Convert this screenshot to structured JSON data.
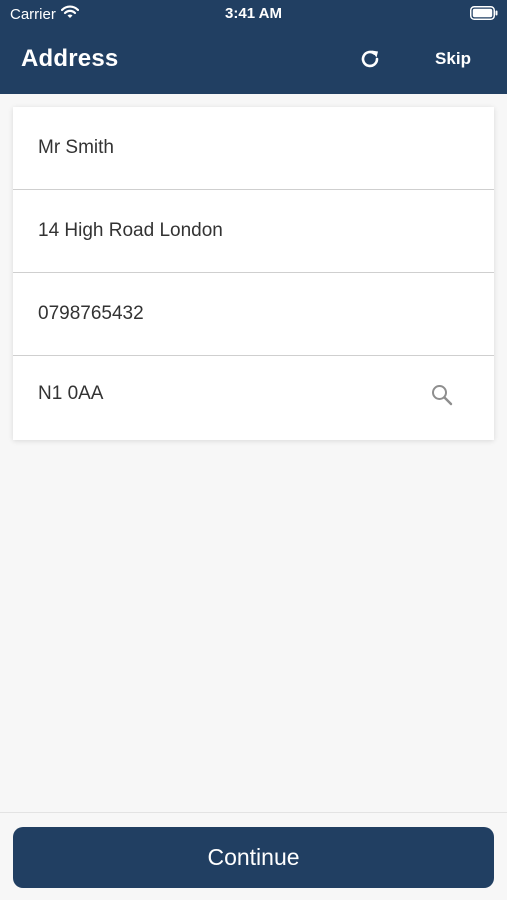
{
  "status_bar": {
    "carrier": "Carrier",
    "time": "3:41 AM"
  },
  "nav": {
    "title": "Address",
    "skip_label": "Skip"
  },
  "form": {
    "fields": [
      {
        "value": "Mr Smith"
      },
      {
        "value": "14 High Road London"
      },
      {
        "value": "0798765432"
      },
      {
        "value": "N1 0AA"
      }
    ]
  },
  "footer": {
    "continue_label": "Continue"
  },
  "colors": {
    "primary": "#213f62",
    "background": "#f7f7f7",
    "card": "#ffffff",
    "divider": "#cfcfcf",
    "icon_muted": "#8e8e8e"
  },
  "icons": {
    "wifi": "wifi-icon",
    "battery": "battery-icon",
    "refresh": "refresh-icon",
    "search": "search-icon"
  }
}
